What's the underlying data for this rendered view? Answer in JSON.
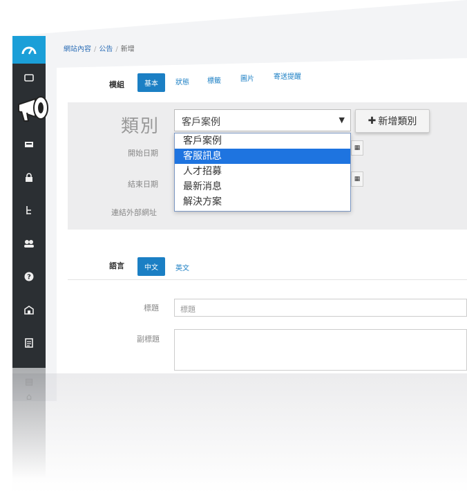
{
  "breadcrumb": {
    "item1": "網站內容",
    "item2": "公告",
    "item3": "新增",
    "sep": "/"
  },
  "module": {
    "label": "模組",
    "tabs": [
      "基本",
      "狀態",
      "標籤",
      "圖片",
      "寄送提醒"
    ],
    "active_tab": 0
  },
  "form": {
    "category_label": "類別",
    "category_value": "客戶案例",
    "category_options": [
      "客戶案例",
      "客服訊息",
      "人才招募",
      "最新消息",
      "解決方案"
    ],
    "highlighted_option": 1,
    "add_category_label": "新增類別",
    "start_date_label": "開始日期",
    "end_date_label": "結束日期",
    "external_url_label": "連結外部網址"
  },
  "language": {
    "label": "語言",
    "tabs": [
      "中文",
      "英文"
    ],
    "active_tab": 0
  },
  "fields": {
    "title_label": "標題",
    "title_placeholder": "標題",
    "subtitle_label": "副標題"
  },
  "icons": {
    "logo": "gauge-logo-icon",
    "sidebar": [
      "monitor-icon",
      "megaphone-icon",
      "inbox-icon",
      "lock-icon",
      "tree-icon",
      "users-icon",
      "help-icon",
      "store-icon",
      "document-icon"
    ]
  },
  "colors": {
    "accent": "#1b7fc4",
    "sidebar": "#2b2f33",
    "logo_bg": "#1b9fd8",
    "dropdown_highlight": "#1e74e0"
  }
}
